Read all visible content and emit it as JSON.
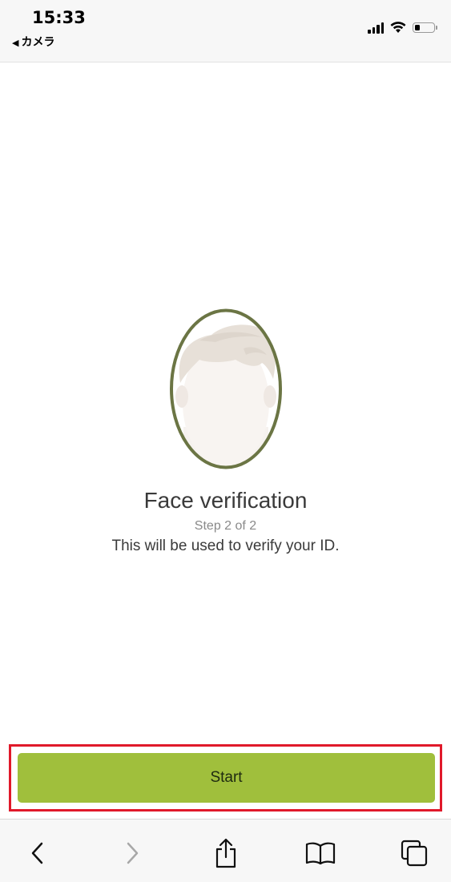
{
  "status_bar": {
    "time": "15:33",
    "back_app_label": "カメラ",
    "back_arrow": "◀",
    "signal_icon": "signal-bars-icon",
    "wifi_icon": "wifi-icon",
    "battery_icon": "battery-icon",
    "battery_level": 0.3
  },
  "verification": {
    "title": "Face verification",
    "step_text": "Step 2 of 2",
    "description": "This will be used to verify your ID.",
    "illustration": "face-oval-icon"
  },
  "start_button": {
    "label": "Start",
    "highlight_color": "#e0192a",
    "button_color": "#a0bf3c"
  },
  "toolbar": {
    "items": [
      "back-icon",
      "forward-icon",
      "share-icon",
      "bookmarks-icon",
      "tabs-icon"
    ]
  }
}
